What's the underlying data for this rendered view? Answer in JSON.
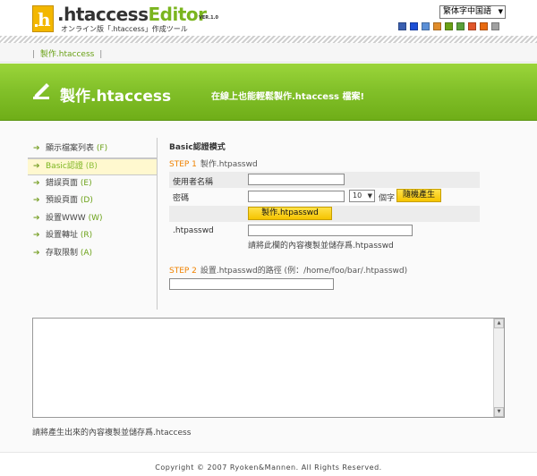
{
  "header": {
    "logo_letter": "h",
    "logo_part1": ".htaccess",
    "logo_part2": "Editor",
    "version": "VER.1.0",
    "subtitle": "オンライン版「.htaccess」作成ツール",
    "language_select": "繁体字中国語",
    "bookmark_icons": [
      {
        "name": "b-bookmark-icon",
        "color": "#3a5fb0"
      },
      {
        "name": "delicious-icon",
        "color": "#1d4fd6"
      },
      {
        "name": "pc-bookmark-icon",
        "color": "#5b8fd6"
      },
      {
        "name": "clip-icon",
        "color": "#e08c2a"
      },
      {
        "name": "add-bookmark-icon",
        "color": "#6aa116"
      },
      {
        "name": "livedoor-icon",
        "color": "#5aa03a"
      },
      {
        "name": "f-bookmark-icon",
        "color": "#e0562a"
      },
      {
        "name": "ring-bookmark-icon",
        "color": "#e86a10"
      },
      {
        "name": "reddit-icon",
        "color": "#a0a0a0"
      }
    ]
  },
  "breadcrumb": {
    "separator": "|",
    "current": "製作.htaccess"
  },
  "banner": {
    "title": "製作.htaccess",
    "subtitle": "在線上也能輕鬆製作.htaccess 檔案!"
  },
  "sidebar": {
    "items": [
      {
        "label": "顯示檔案列表",
        "key": "(F)"
      },
      {
        "label": "Basic認證",
        "key": "(B)"
      },
      {
        "label": "錯誤頁面",
        "key": "(E)"
      },
      {
        "label": "預設頁面",
        "key": "(D)"
      },
      {
        "label": "設置WWW",
        "key": "(W)"
      },
      {
        "label": "設置轉址",
        "key": "(R)"
      },
      {
        "label": "存取限制",
        "key": "(A)"
      }
    ]
  },
  "main": {
    "section_title": "Basic認證模式",
    "step1": {
      "no": "STEP 1",
      "title": "製作.htpasswd"
    },
    "username_label": "使用者名稱",
    "username_value": "",
    "password_label": "密碼",
    "password_value": "",
    "length_value": "10",
    "length_unit": "個字",
    "random_button": "隨機產生",
    "make_button": "製作.htpasswd",
    "htpasswd_label": ".htpasswd",
    "htpasswd_value": "",
    "htpasswd_note": "請將此欄的內容複製並儲存爲.htpasswd",
    "step2": {
      "no": "STEP 2",
      "title": "設置.htpasswd的路徑 (例：/home/foo/bar/.htpasswd)"
    },
    "path_value": ""
  },
  "output": {
    "value": "",
    "note": "請將產生出來的內容複製並儲存爲.htaccess"
  },
  "footer": {
    "copyright": "Copyright © 2007 Ryoken&Mannen. All Rights Reserved."
  },
  "colors": {
    "accent_green": "#7bb51f",
    "button_yellow": "#f5c400",
    "step_orange": "#f08200"
  }
}
